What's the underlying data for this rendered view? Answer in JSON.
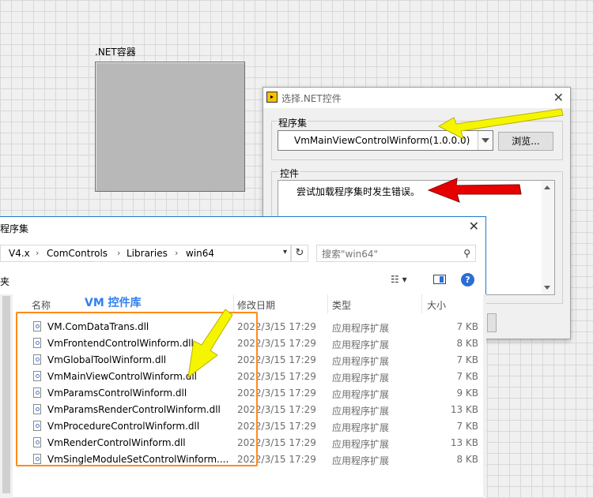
{
  "container": {
    "label": ".NET容器"
  },
  "dialog": {
    "title": "选择.NET控件",
    "assembly_group": "程序集",
    "assembly_value": "VmMainViewControlWinform(1.0.0.0)",
    "browse_label": "浏览...",
    "control_group": "控件",
    "error_message": "尝试加载程序集时发生错误。"
  },
  "explorer": {
    "title": "程序集",
    "breadcrumbs": [
      "V4.x",
      "ComControls",
      "Libraries",
      "win64"
    ],
    "search_placeholder": "搜索\"win64\"",
    "toolbar_text": "夹",
    "columns": {
      "name": "名称",
      "date": "修改日期",
      "type": "类型",
      "size": "大小"
    },
    "files": [
      {
        "name": "VM.ComDataTrans.dll",
        "date": "2022/3/15 17:29",
        "type": "应用程序扩展",
        "size": "7 KB"
      },
      {
        "name": "VmFrontendControlWinform.dll",
        "date": "2022/3/15 17:29",
        "type": "应用程序扩展",
        "size": "8 KB"
      },
      {
        "name": "VmGlobalToolWinform.dll",
        "date": "2022/3/15 17:29",
        "type": "应用程序扩展",
        "size": "7 KB"
      },
      {
        "name": "VmMainViewControlWinform.dll",
        "date": "2022/3/15 17:29",
        "type": "应用程序扩展",
        "size": "7 KB"
      },
      {
        "name": "VmParamsControlWinform.dll",
        "date": "2022/3/15 17:29",
        "type": "应用程序扩展",
        "size": "9 KB"
      },
      {
        "name": "VmParamsRenderControlWinform.dll",
        "date": "2022/3/15 17:29",
        "type": "应用程序扩展",
        "size": "13 KB"
      },
      {
        "name": "VmProcedureControlWinform.dll",
        "date": "2022/3/15 17:29",
        "type": "应用程序扩展",
        "size": "7 KB"
      },
      {
        "name": "VmRenderControlWinform.dll",
        "date": "2022/3/15 17:29",
        "type": "应用程序扩展",
        "size": "13 KB"
      },
      {
        "name": "VmSingleModuleSetControlWinform....",
        "date": "2022/3/15 17:29",
        "type": "应用程序扩展",
        "size": "8 KB"
      }
    ]
  },
  "annotation": {
    "label": "VM 控件库",
    "box_color": "#ff8c1a",
    "label_color": "#2f7ff0",
    "arrow_yellow": "#f5f500",
    "arrow_red": "#e60000"
  },
  "icons": {
    "close": "✕",
    "refresh": "↻",
    "search": "⚲",
    "view": "☷ ▾",
    "help": "?",
    "chevron": "›",
    "dropdown": "▾"
  }
}
